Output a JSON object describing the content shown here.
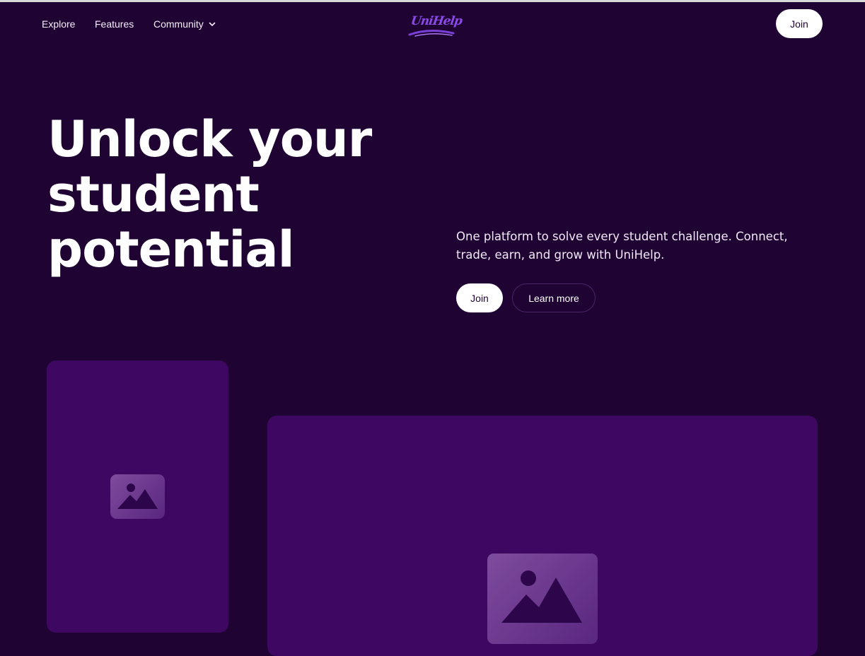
{
  "nav": {
    "links": {
      "explore": "Explore",
      "features": "Features",
      "community": "Community"
    },
    "community_icon": "chevron-down-icon",
    "logo_text": "UniHelp",
    "join_label": "Join"
  },
  "hero": {
    "title_line1": "Unlock your",
    "title_line2": "student",
    "title_line3": "potential",
    "description": "One platform to solve every student challenge. Connect, trade, earn, and grow with UniHelp.",
    "join_label": "Join",
    "learn_more_label": "Learn more"
  },
  "media": {
    "placeholder_icon": "image-icon"
  },
  "colors": {
    "background": "#1f0333",
    "card": "#3d0762",
    "accent": "#8b49e8",
    "button_bg": "#ffffff"
  }
}
